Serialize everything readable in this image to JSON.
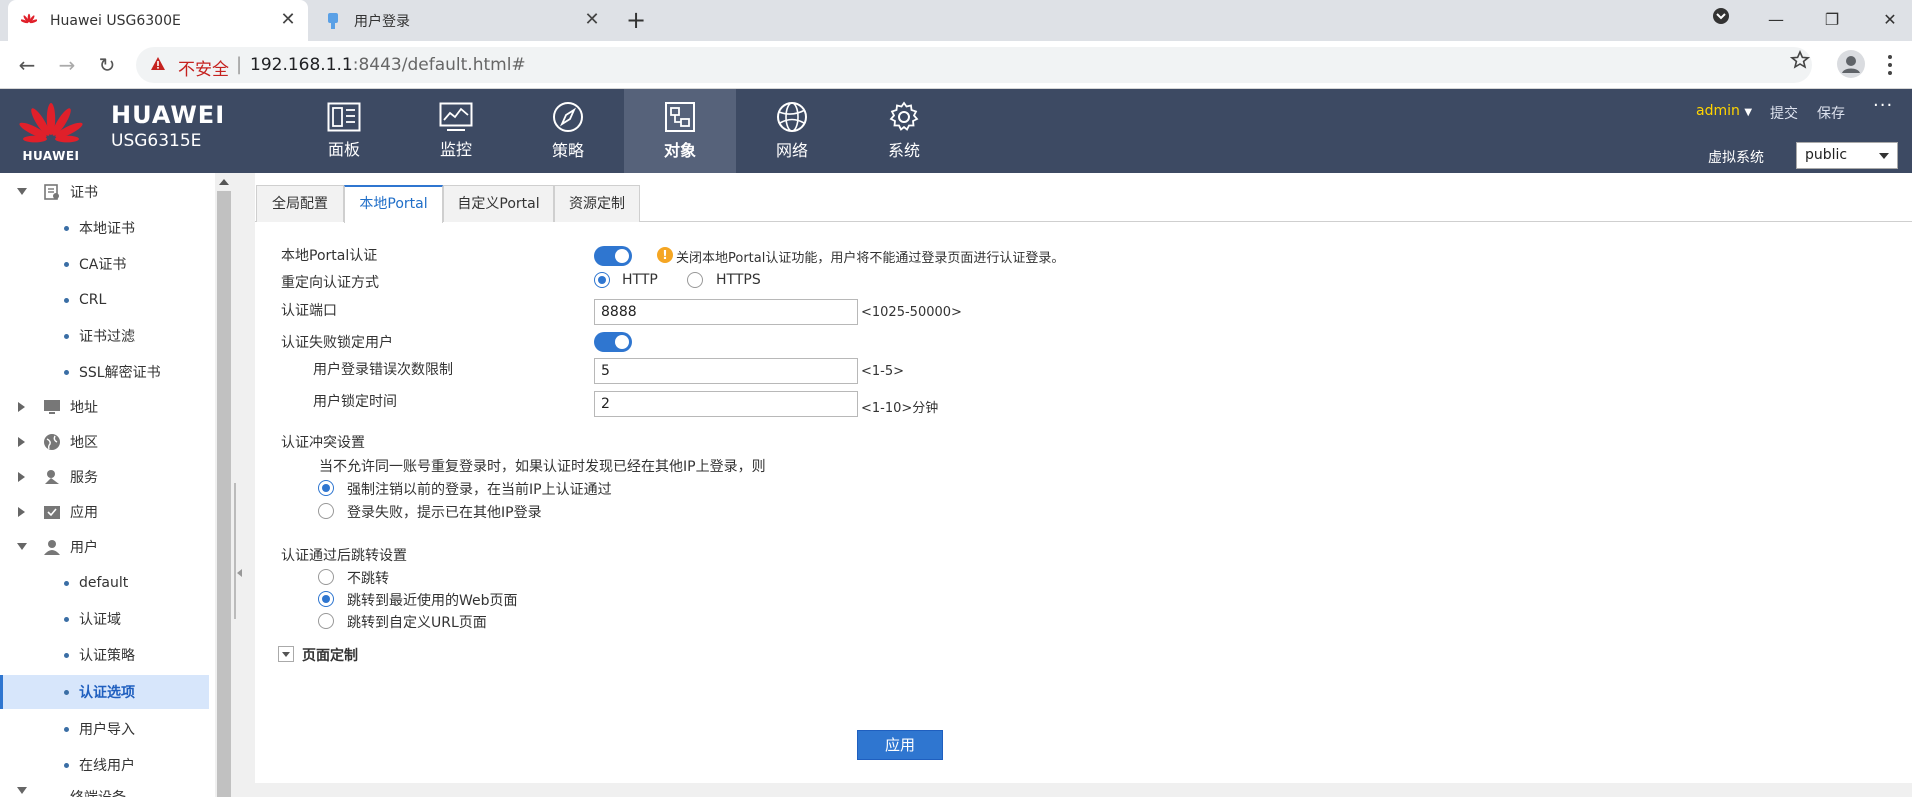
{
  "browser": {
    "tabs": [
      {
        "title": "Huawei USG6300E",
        "active": true
      },
      {
        "title": "用户登录",
        "active": false
      }
    ],
    "security_label": "不安全",
    "url_host": "192.168.1.1",
    "url_rest": ":8443/default.html#"
  },
  "header": {
    "logo_text": "HUAWEI",
    "brand": "HUAWEI",
    "model": "USG6315E",
    "nav": [
      {
        "label": "面板",
        "icon": "dashboard-icon",
        "active": false
      },
      {
        "label": "监控",
        "icon": "monitor-icon",
        "active": false
      },
      {
        "label": "策略",
        "icon": "compass-icon",
        "active": false
      },
      {
        "label": "对象",
        "icon": "object-icon",
        "active": true
      },
      {
        "label": "网络",
        "icon": "globe-icon",
        "active": false
      },
      {
        "label": "系统",
        "icon": "gear-icon",
        "active": false
      }
    ],
    "user": "admin",
    "commit": "提交",
    "save": "保存",
    "vsys_label": "虚拟系统",
    "vsys_value": "public"
  },
  "sidebar": {
    "items": [
      {
        "label": "证书",
        "type": "group",
        "expanded": true,
        "icon": "certificate-icon"
      },
      {
        "label": "本地证书",
        "type": "leaf"
      },
      {
        "label": "CA证书",
        "type": "leaf"
      },
      {
        "label": "CRL",
        "type": "leaf"
      },
      {
        "label": "证书过滤",
        "type": "leaf"
      },
      {
        "label": "SSL解密证书",
        "type": "leaf"
      },
      {
        "label": "地址",
        "type": "group",
        "expanded": false,
        "icon": "monitor-small-icon"
      },
      {
        "label": "地区",
        "type": "group",
        "expanded": false,
        "icon": "globe-small-icon"
      },
      {
        "label": "服务",
        "type": "group",
        "expanded": false,
        "icon": "service-icon"
      },
      {
        "label": "应用",
        "type": "group",
        "expanded": false,
        "icon": "app-icon"
      },
      {
        "label": "用户",
        "type": "group",
        "expanded": true,
        "icon": "user-icon"
      },
      {
        "label": "default",
        "type": "leaf"
      },
      {
        "label": "认证域",
        "type": "leaf"
      },
      {
        "label": "认证策略",
        "type": "leaf"
      },
      {
        "label": "认证选项",
        "type": "leaf",
        "selected": true
      },
      {
        "label": "用户导入",
        "type": "leaf"
      },
      {
        "label": "在线用户",
        "type": "leaf"
      },
      {
        "label": "终端设备",
        "type": "group",
        "expanded": true,
        "icon": "device-icon"
      }
    ]
  },
  "tabs": [
    "全局配置",
    "本地Portal",
    "自定义Portal",
    "资源定制"
  ],
  "form": {
    "portal_auth_label": "本地Portal认证",
    "portal_auth_on": true,
    "portal_warning": "关闭本地Portal认证功能，用户将不能通过登录页面进行认证登录。",
    "redirect_label": "重定向认证方式",
    "redirect_options": [
      "HTTP",
      "HTTPS"
    ],
    "redirect_selected": "HTTP",
    "port_label": "认证端口",
    "port_value": "8888",
    "port_hint": "<1025-50000>",
    "lock_label": "认证失败锁定用户",
    "lock_on": true,
    "max_errors_label": "用户登录错误次数限制",
    "max_errors_value": "5",
    "max_errors_hint": "<1-5>",
    "lock_time_label": "用户锁定时间",
    "lock_time_value": "2",
    "lock_time_hint": "<1-10>分钟",
    "conflict_label": "认证冲突设置",
    "conflict_desc": "当不允许同一账号重复登录时，如果认证时发现已经在其他IP上登录，则",
    "conflict_options": [
      "强制注销以前的登录，在当前IP上认证通过",
      "登录失败，提示已在其他IP登录"
    ],
    "conflict_selected": 0,
    "redirect_after_label": "认证通过后跳转设置",
    "redirect_after_options": [
      "不跳转",
      "跳转到最近使用的Web页面",
      "跳转到自定义URL页面"
    ],
    "redirect_after_selected": 1,
    "page_custom_label": "页面定制",
    "apply": "应用"
  }
}
